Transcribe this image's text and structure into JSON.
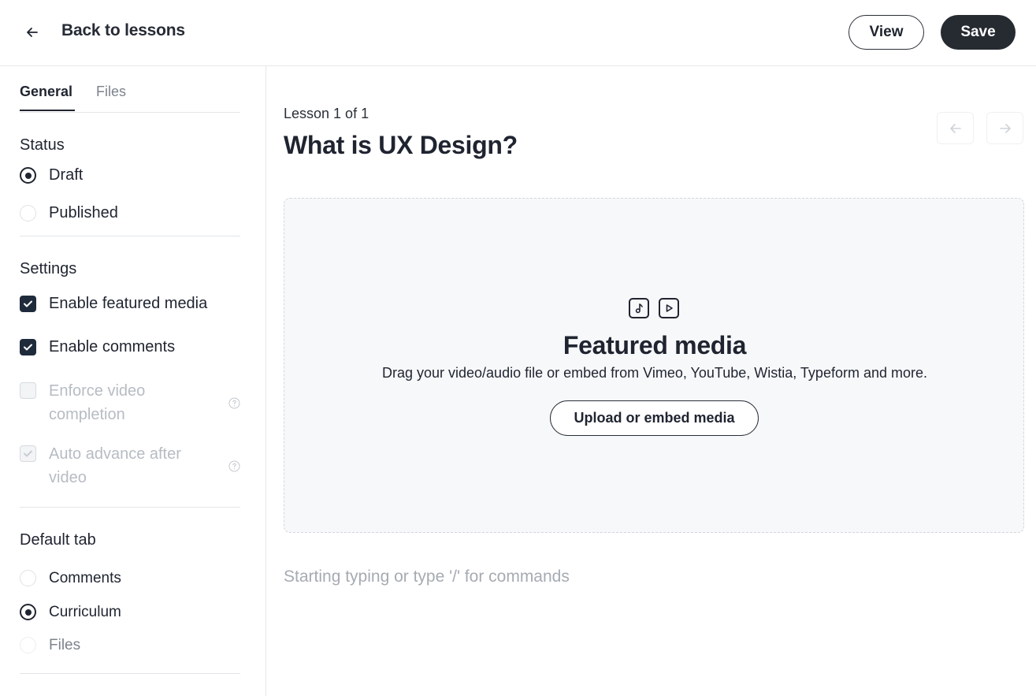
{
  "header": {
    "back_label": "Back to lessons",
    "view_label": "View",
    "save_label": "Save"
  },
  "sidebar": {
    "tabs": [
      {
        "label": "General",
        "active": true
      },
      {
        "label": "Files",
        "active": false
      }
    ],
    "status": {
      "title": "Status",
      "options": [
        {
          "label": "Draft",
          "selected": true
        },
        {
          "label": "Published",
          "selected": false
        }
      ]
    },
    "settings": {
      "title": "Settings",
      "options": [
        {
          "label": "Enable featured media",
          "checked": true,
          "disabled": false
        },
        {
          "label": "Enable comments",
          "checked": true,
          "disabled": false
        },
        {
          "label": "Enforce video completion",
          "checked": false,
          "disabled": true
        },
        {
          "label": "Auto advance after video",
          "checked": true,
          "disabled": true
        }
      ]
    },
    "default_tab": {
      "title": "Default tab",
      "options": [
        {
          "label": "Comments",
          "selected": false
        },
        {
          "label": "Curriculum",
          "selected": true
        },
        {
          "label": "Files",
          "selected": false
        }
      ]
    }
  },
  "main": {
    "lesson_count": "Lesson 1 of 1",
    "title": "What is UX Design?",
    "featured_media": {
      "title": "Featured media",
      "description": "Drag your video/audio file or embed from Vimeo, YouTube, Wistia, Typeform and more.",
      "button_label": "Upload or embed media"
    },
    "editor_placeholder": "Starting typing or type '/' for commands"
  },
  "colors": {
    "primary": "#262a31",
    "text": "#1f2430",
    "muted": "#7d838c",
    "disabled": "#b7bcc3",
    "dropzone_bg": "#f7f8fa"
  }
}
